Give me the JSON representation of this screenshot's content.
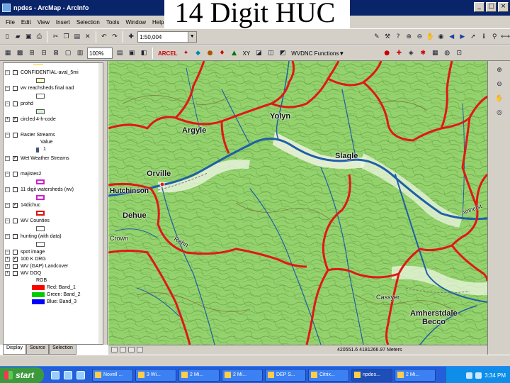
{
  "slide_heading": "14 Digit HUC",
  "window": {
    "title": "npdes - ArcMap - ArcInfo",
    "min": "_",
    "max": "□",
    "close": "×"
  },
  "menu": [
    "File",
    "Edit",
    "View",
    "Insert",
    "Selection",
    "Tools",
    "Window",
    "Help"
  ],
  "toolbar": {
    "scale": "1:50,004",
    "zoom_percent": "100%",
    "label_arcel": "ARCEL",
    "label_xy": "XY",
    "functions_dropdown": "WVDNC Functions▼"
  },
  "toc": {
    "layers": [
      {
        "name": "CONFIDENTIAL-aval_5mi",
        "sign": "−",
        "checked": false,
        "swatch": "#ffffcc"
      },
      {
        "name": "wv reachsheds final nad",
        "sign": "−",
        "checked": false,
        "swatch": "#ffffff"
      },
      {
        "name": "prohd",
        "sign": "−",
        "checked": false,
        "swatch": "#d8f0d8"
      },
      {
        "name": "circled 4-h-code",
        "sign": "+",
        "checked": true,
        "swatch": null
      },
      {
        "name": "Raster Streams",
        "sign": "−",
        "checked": false,
        "swatch": null
      },
      {
        "name": "Value",
        "sign": "",
        "checked": null,
        "swatch": null
      },
      {
        "name": "1",
        "sign": "",
        "checked": null,
        "swatch": "#2255cc"
      },
      {
        "name": "Wet Weather Streams",
        "sign": "−",
        "checked": true,
        "swatch": null
      },
      {
        "name": "majistes2",
        "sign": "−",
        "checked": false,
        "swatch": "#cc22cc"
      },
      {
        "name": "11 digit watersheds (wv)",
        "sign": "−",
        "checked": false,
        "swatch": "#cc22cc"
      },
      {
        "name": "14dichuc",
        "sign": "−",
        "checked": true,
        "swatch": "#dd1111"
      },
      {
        "name": "WV Counties",
        "sign": "−",
        "checked": false,
        "swatch": "#ffffff"
      },
      {
        "name": "hunting (with data)",
        "sign": "−",
        "checked": false,
        "swatch": "#ffffff"
      },
      {
        "name": "spot image",
        "sign": "−",
        "checked": false,
        "swatch": null
      },
      {
        "name": "100 K DRG",
        "sign": "+",
        "checked": true,
        "swatch": null
      },
      {
        "name": "WV (GAP) Landcover",
        "sign": "+",
        "checked": false,
        "swatch": null
      },
      {
        "name": "WV DOQ",
        "sign": "+",
        "checked": false,
        "swatch": null
      },
      {
        "name": "RGB",
        "sign": "",
        "checked": null,
        "swatch": null
      }
    ],
    "rgb": [
      {
        "label": "Red: Band_1",
        "color": "#ff0000"
      },
      {
        "label": "Green: Band_2",
        "color": "#00cc00"
      },
      {
        "label": "Blue: Band_3",
        "color": "#0000ff"
      }
    ],
    "tabs": [
      "Display",
      "Source",
      "Selection"
    ]
  },
  "map": {
    "labels": [
      "Yolyn",
      "Argyle",
      "Slagle",
      "Orville",
      "Hutchinson",
      "Dehue",
      "Amherstdale",
      "Becco",
      "Crown",
      "Cassyer",
      "Rehn",
      "Amherst"
    ]
  },
  "status": {
    "coords": "420551.6  4181266.97 Meters"
  },
  "taskbar": {
    "start": "start",
    "tasks": [
      "Novell ...",
      "3 Wi...",
      "2 Mi...",
      "2 Mi...",
      "DEP S...",
      "Citrix...",
      "npdes...",
      "2 Mi..."
    ],
    "clock": "3:34 PM"
  }
}
